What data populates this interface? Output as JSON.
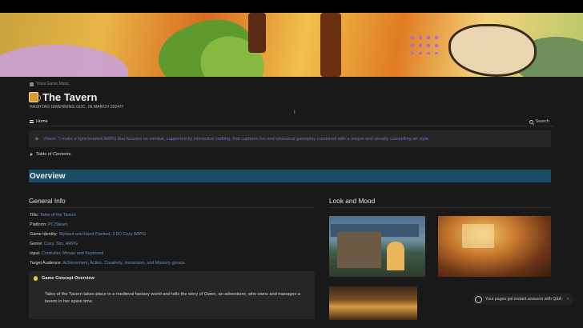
{
  "breadcrumb": "Yokai Game Music",
  "page": {
    "title": "The Tavern",
    "subtitle": "HASHTAG GWENNING GDC, IN MARCH 2024!!!"
  },
  "nav": {
    "home_label": "Home",
    "search_label": "Search"
  },
  "callout": {
    "text": "Vision: \"I make a light-hearted ARPG that focuses on combat, supported by interactive crafting, that captures fun and whimsical gameplay combined with a unique and visually compelling art style."
  },
  "toc_label": "Table of Contents",
  "overview_heading": "Overview",
  "general_info": {
    "heading": "General Info",
    "items": [
      {
        "label": "Title:",
        "value": "Tales of the Tavern"
      },
      {
        "label": "Platform:",
        "value": "PC/Steam"
      },
      {
        "label": "Game Identity:",
        "value": "Stylized and Hand-Painted, 2.5D Cozy ARPG"
      },
      {
        "label": "Genre:",
        "value": "Cozy, Sim, ARPG"
      },
      {
        "label": "Input:",
        "value": "Controller, Mouse and Keyboard"
      },
      {
        "label": "Target Audience:",
        "value": "Achievement, Action, Creativity, Immersion, and Mastery groups"
      }
    ]
  },
  "concept": {
    "heading": "Game Concept Overview",
    "text": "Tales of the Tavern takes place in a medieval fantasy world and tells the story of Gwen, an adventurer, who owns and manages a tavern in her spare time."
  },
  "look_heading": "Look and Mood",
  "qa_prompt": "Your pages get instant answers with Q&A",
  "colors": {
    "page_bg": "#191919",
    "overview_bar": "#1c4c66",
    "link": "#6f8fc2",
    "callout_text": "#7d6bc4"
  }
}
